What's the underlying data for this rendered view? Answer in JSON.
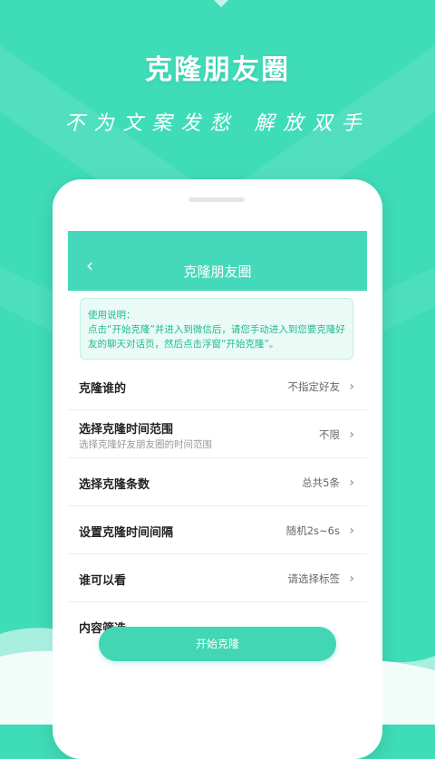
{
  "promo": {
    "title": "克隆朋友圈",
    "slogan": "不为文案发愁 解放双手"
  },
  "header": {
    "back_icon": "chevron-left-icon",
    "title": "克隆朋友圈"
  },
  "notice": {
    "title": "使用说明：",
    "body": "点击“开始克隆”并进入到微信后，请您手动进入到您要克隆好友的聊天对话页，然后点击浮窗“开始克隆”。"
  },
  "rows": [
    {
      "label": "克隆谁的",
      "sub": "",
      "value": "不指定好友"
    },
    {
      "label": "选择克隆时间范围",
      "sub": "选择克隆好友朋友圈的时间范围",
      "value": "不限"
    },
    {
      "label": "选择克隆条数",
      "sub": "",
      "value": "总共5条"
    },
    {
      "label": "设置克隆时间间隔",
      "sub": "",
      "value": "随机2s~6s"
    },
    {
      "label": "谁可以看",
      "sub": "",
      "value": "请选择标签"
    },
    {
      "label": "内容筛选",
      "sub": "",
      "value": ""
    }
  ],
  "start_button": {
    "label": "开始克隆"
  },
  "colors": {
    "background": "#3fdcb8",
    "accent": "#45d9bb",
    "notice_text": "#23b894"
  }
}
